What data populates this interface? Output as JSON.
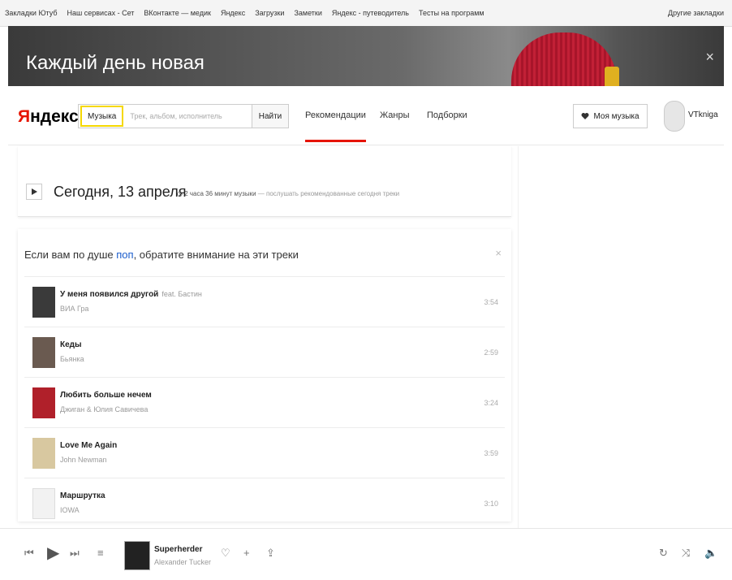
{
  "bookmarks": {
    "items": [
      "Закладки Ютуб",
      "Наш сервисах - Сет",
      "ВКонтакте — медик",
      "Яндекс",
      "Загрузки",
      "Заметки",
      "Яндекс - путеводитель",
      "Тесты на программ"
    ],
    "other": "Другие закладки"
  },
  "banner": {
    "title": "Каждый день новая",
    "close": "×"
  },
  "header": {
    "logo_first": "Я",
    "logo_rest": "ндекс",
    "search_scope": "Музыка",
    "search_placeholder": "Трек, альбом, исполнитель",
    "search_button": "Найти",
    "nav": [
      "Рекомендации",
      "Жанры",
      "Подборки"
    ],
    "my_music": "Моя музыка",
    "username": "VTkniga"
  },
  "today": {
    "date": "Сегодня, 13 апреля",
    "duration": "2 часа 36 минут музыки",
    "hint": "— послушать рекомендованные сегодня треки"
  },
  "recommend": {
    "prefix": "Если вам по душе ",
    "genre": "поп",
    "suffix": ", обратите внимание на эти треки",
    "close": "×"
  },
  "tracks": [
    {
      "title": "У меня появился другой",
      "feat": "feat. Бастин",
      "artist": "ВИА Гра",
      "duration": "3:54"
    },
    {
      "title": "Кеды",
      "feat": "",
      "artist": "Бьянка",
      "duration": "2:59"
    },
    {
      "title": "Любить больше нечем",
      "feat": "",
      "artist": "Джиган & Юлия Савичева",
      "duration": "3:24"
    },
    {
      "title": "Love Me Again",
      "feat": "",
      "artist": "John Newman",
      "duration": "3:59"
    },
    {
      "title": "Маршрутка",
      "feat": "",
      "artist": "IOWA",
      "duration": "3:10"
    }
  ],
  "player": {
    "track": "Superherder",
    "artist": "Alexander Tucker"
  },
  "colors": {
    "accent": "#e61400",
    "search_highlight": "#f5d800",
    "link": "#1a5ccc"
  }
}
